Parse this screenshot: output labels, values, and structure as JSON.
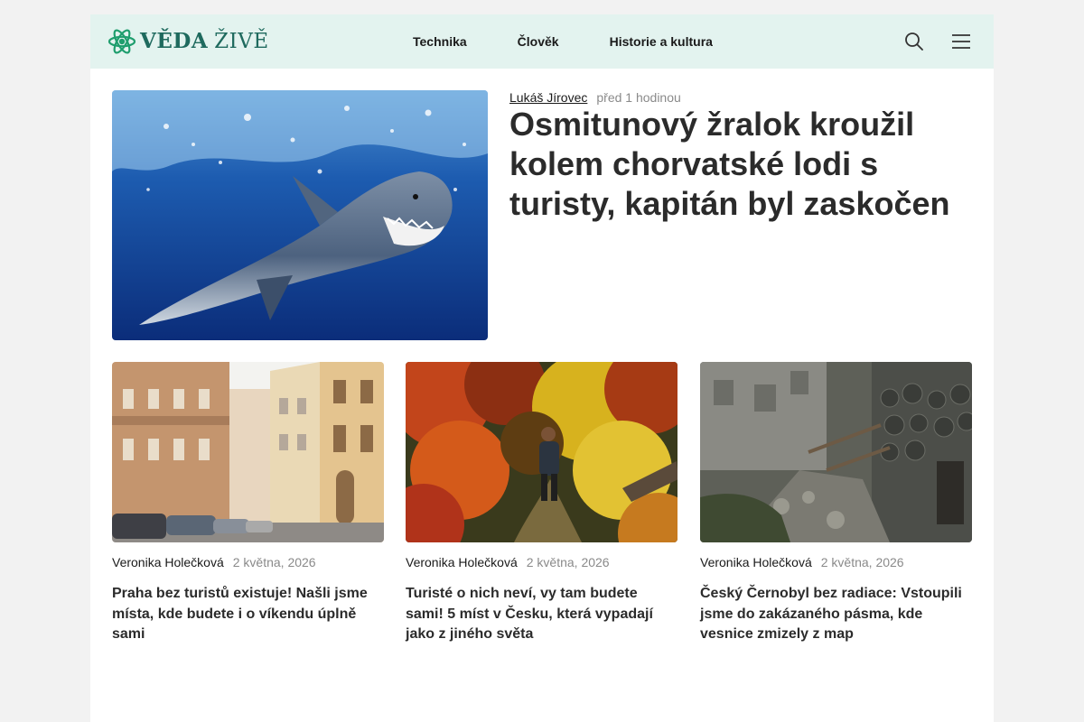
{
  "brand": {
    "name_strong": "VĚDA",
    "name_light": "ŽIVĚ",
    "color": "#1f6a5e",
    "header_bg": "#e3f3ef"
  },
  "nav": {
    "items": [
      {
        "label": "Technika"
      },
      {
        "label": "Člověk"
      },
      {
        "label": "Historie a kultura"
      }
    ]
  },
  "header_icons": [
    "search-icon",
    "hamburger-menu-icon"
  ],
  "featured": {
    "author": "Lukáš Jírovec",
    "time": "před 1 hodinou",
    "title": "Osmitunový žralok kroužil kolem chorvatské lodi s turisty, kapitán byl zaskočen"
  },
  "articles": [
    {
      "author": "Veronika Holečková",
      "date": "2 května, 2026",
      "title": "Praha bez turistů existuje! Našli jsme místa, kde budete i o víkendu úplně sami"
    },
    {
      "author": "Veronika Holečková",
      "date": "2 května, 2026",
      "title": "Turisté o nich neví, vy tam budete sami! 5 míst v Česku, která vypadají jako z jiného světa"
    },
    {
      "author": "Veronika Holečková",
      "date": "2 května, 2026",
      "title": "Český Černobyl bez radiace: Vstoupili jsme do zakázaného pásma, kde vesnice zmizely z map"
    }
  ]
}
